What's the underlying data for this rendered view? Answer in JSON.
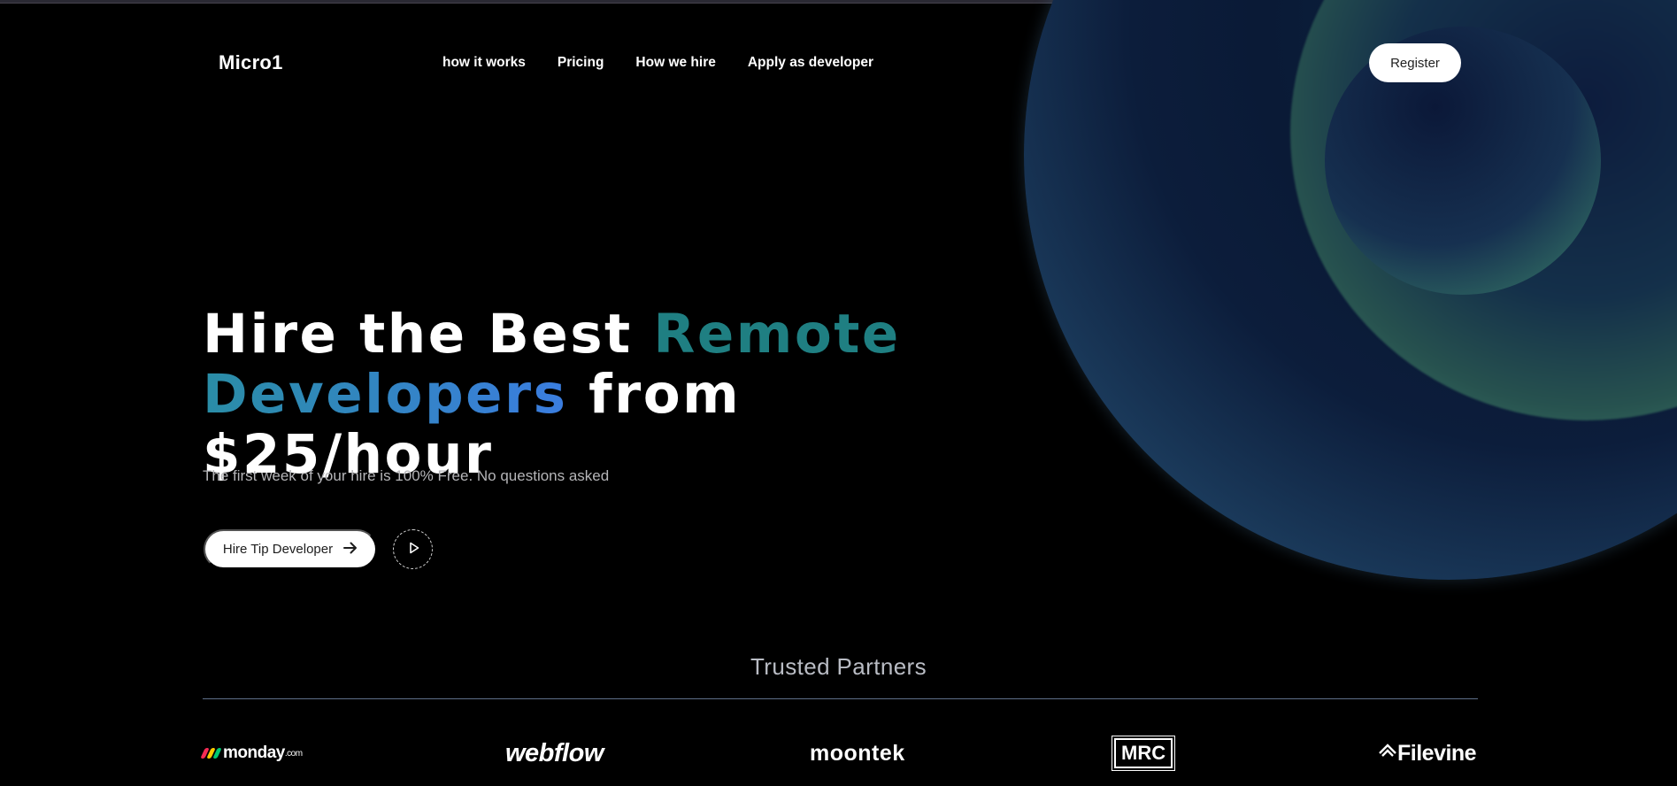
{
  "brand": {
    "name": "Micro1"
  },
  "nav": {
    "items": [
      "how it works",
      "Pricing",
      "How we hire",
      "Apply as developer"
    ]
  },
  "header": {
    "register_label": "Register"
  },
  "hero": {
    "title_part1": "Hire the Best ",
    "title_accent1": "Remote",
    "title_accent2": "Developers",
    "title_part2": " from $25/hour",
    "subtitle": "The first week of your hire is 100% Free. No questions asked",
    "cta_label": "Hire Tip Developer",
    "cta_icon": "arrow-right-icon",
    "play_icon": "play-icon"
  },
  "partners": {
    "title": "Trusted Partners",
    "logos": {
      "monday": {
        "text": "monday",
        "suffix": ".com"
      },
      "webflow": {
        "text": "webflow"
      },
      "moontek": {
        "text": "moontek"
      },
      "mrc": {
        "text": "MRC"
      },
      "filevine": {
        "text": "Filevine"
      }
    }
  },
  "colors": {
    "background": "#000000",
    "accent_teal": "#1f7f82",
    "accent_blue": "#3b7de0",
    "orb_green": "#4d8f77",
    "orb_navy": "#0a1a36"
  }
}
